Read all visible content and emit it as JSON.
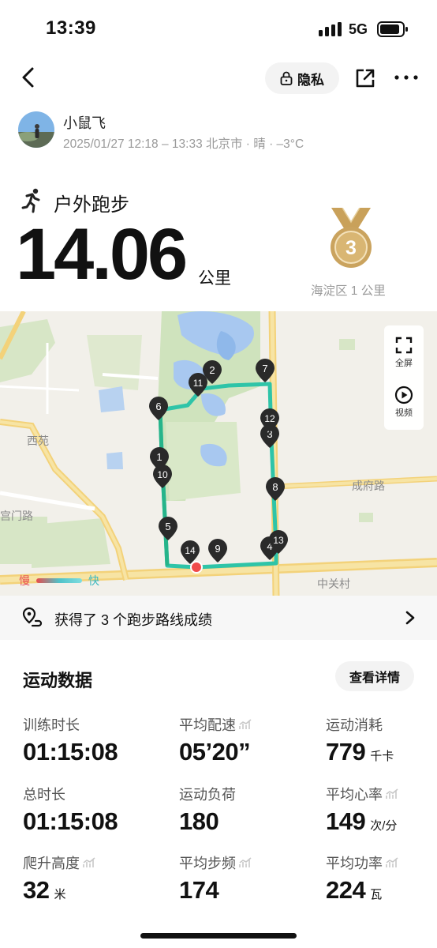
{
  "status_bar": {
    "time": "13:39",
    "network": "5G"
  },
  "header": {
    "privacy_label": "隐私"
  },
  "user": {
    "name": "小鼠飞",
    "meta": "2025/01/27 12:18 – 13:33 北京市 · 晴 · –3°C"
  },
  "activity": {
    "type": "户外跑步",
    "distance": "14.06",
    "distance_unit": "公里",
    "medal_rank": "3",
    "medal_label": "海淀区 1 公里"
  },
  "map": {
    "labels": {
      "xiyuan": "西苑",
      "gongmenlu": "宫门路",
      "chengfulu": "成府路",
      "zhongguancun": "中关村"
    },
    "controls": {
      "fullscreen": "全屏",
      "video": "视频"
    },
    "pace_legend": {
      "slow": "慢",
      "fast": "快"
    },
    "markers": [
      "1",
      "2",
      "3",
      "4",
      "5",
      "6",
      "7",
      "8",
      "9",
      "10",
      "11",
      "12",
      "13",
      "14"
    ]
  },
  "records": {
    "text": "获得了 3 个跑步路线成绩"
  },
  "stats": {
    "title": "运动数据",
    "details_button": "查看详情",
    "items": [
      {
        "label": "训练时长",
        "value": "01:15:08",
        "unit": ""
      },
      {
        "label": "平均配速",
        "value": "05’20”",
        "unit": ""
      },
      {
        "label": "运动消耗",
        "value": "779",
        "unit": "千卡"
      },
      {
        "label": "总时长",
        "value": "01:15:08",
        "unit": ""
      },
      {
        "label": "运动负荷",
        "value": "180",
        "unit": ""
      },
      {
        "label": "平均心率",
        "value": "149",
        "unit": "次/分"
      },
      {
        "label": "爬升高度",
        "value": "32",
        "unit": "米"
      },
      {
        "label": "平均步频",
        "value": "174",
        "unit": ""
      },
      {
        "label": "平均功率",
        "value": "224",
        "unit": "瓦"
      }
    ]
  },
  "colors": {
    "route": "#2ec4a8",
    "medal": "#c9a15a",
    "start_dot": "#f04a4a"
  }
}
